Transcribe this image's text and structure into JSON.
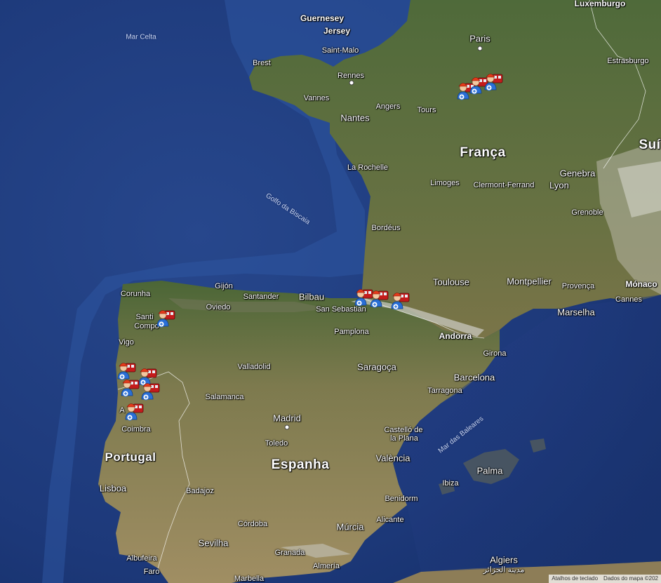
{
  "colors": {
    "ocean": "#22407f",
    "land": "#5d6b3c",
    "arid": "#a08e63",
    "mountain": "#c9c8bf"
  },
  "labels": {
    "mar_celta": "Mar Celta",
    "golfo_biscaia": "Golfo da Biscaia",
    "mar_baleares": "Mar das Baleares",
    "guernesey": "Guernesey",
    "jersey": "Jersey",
    "luxemburgo": "Luxemburgo",
    "paris": "Paris",
    "brest": "Brest",
    "saint_malo": "Saint-Malo",
    "rennes": "Rennes",
    "vannes": "Vannes",
    "angers": "Angers",
    "tours": "Tours",
    "nantes": "Nantes",
    "estrasburgo": "Estrasburgo",
    "franca": "França",
    "suica": "Suí",
    "genebra": "Genebra",
    "lyon": "Lyon",
    "la_rochelle": "La Rochelle",
    "limoges": "Limoges",
    "clermont": "Clermont-Ferrand",
    "grenoble": "Grenoble",
    "bordeus": "Bordéus",
    "toulouse": "Toulouse",
    "montpellier": "Montpellier",
    "provenca": "Provença",
    "monaco": "Mónaco",
    "cannes": "Cannes",
    "marselha": "Marselha",
    "corunha": "Corunha",
    "gijon": "Gijón",
    "santander": "Santander",
    "bilbao": "Bilbau",
    "oviedo": "Oviedo",
    "san_sebastian": "San Sebastian",
    "santiago_1": "Santi",
    "santiago_2": "Compo",
    "pamplona": "Pamplona",
    "andorra": "Andorra",
    "vigo": "Vigo",
    "girona": "Girona",
    "valladolid": "Valladolid",
    "saragoca": "Saragoça",
    "barcelona": "Barcelona",
    "tarragona": "Tarragona",
    "salamanca": "Salamanca",
    "madrid": "Madrid",
    "castello_1": "Castelló de",
    "castello_2": "la Plana",
    "coimbra": "Coimbra",
    "toledo": "Toledo",
    "portugal": "Portugal",
    "espanha": "Espanha",
    "valencia": "València",
    "palma": "Palma",
    "lisboa": "Lisboa",
    "badajoz": "Badajoz",
    "ibiza": "Ibiza",
    "benidorm": "Benidorm",
    "cordoba": "Córdoba",
    "alicante": "Alicante",
    "murcia": "Múrcia",
    "sevilha": "Sevilha",
    "granada": "Granada",
    "albufeira": "Albufeira",
    "faro": "Faro",
    "almeria": "Almería",
    "algiers": "Algiers",
    "algiers_ar": "مدينة الجزائر",
    "marbella": "Marbella",
    "aveiro_partial": "A"
  },
  "markers": [
    {
      "name": "fire-team-marker-paris-1",
      "icon": "firefighter-group-icon"
    },
    {
      "name": "fire-team-marker-paris-2",
      "icon": "firefighter-group-icon"
    },
    {
      "name": "fire-team-marker-paris-3",
      "icon": "firefighter-group-icon"
    },
    {
      "name": "fire-team-marker-basque-1",
      "icon": "firefighter-group-icon"
    },
    {
      "name": "fire-team-marker-basque-2",
      "icon": "firefighter-group-icon"
    },
    {
      "name": "fire-team-marker-pyrenees",
      "icon": "firefighter-group-icon"
    },
    {
      "name": "fire-team-marker-santiago",
      "icon": "firefighter-group-icon"
    },
    {
      "name": "fire-team-marker-porto-1",
      "icon": "firefighter-group-icon"
    },
    {
      "name": "fire-team-marker-porto-2",
      "icon": "firefighter-group-icon"
    },
    {
      "name": "fire-team-marker-porto-3",
      "icon": "firefighter-group-icon"
    },
    {
      "name": "fire-team-marker-porto-4",
      "icon": "firefighter-group-icon"
    },
    {
      "name": "fire-team-marker-aveiro",
      "icon": "firefighter-group-icon"
    }
  ],
  "attribution": {
    "shortcuts": "Atalhos de teclado",
    "map_data": "Dados do mapa ©202"
  }
}
